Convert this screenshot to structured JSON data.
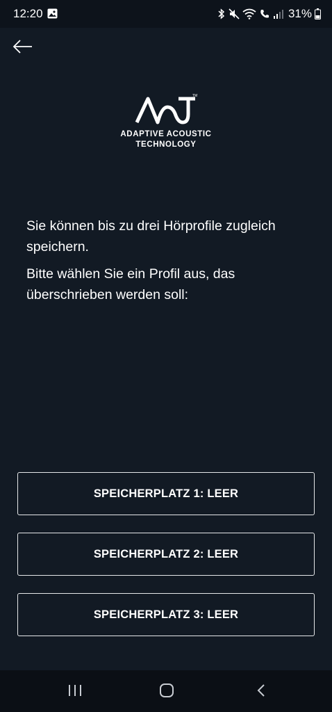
{
  "status_bar": {
    "time": "12:20",
    "battery": "31%",
    "icons": [
      "gallery-icon",
      "bluetooth-icon",
      "mute-icon",
      "wifi-icon",
      "call-icon",
      "signal-icon",
      "battery-icon"
    ]
  },
  "header": {
    "back_icon": "arrow-left-icon"
  },
  "logo": {
    "line1": "ADAPTIVE ACOUSTIC",
    "line2": "TECHNOLOGY"
  },
  "content": {
    "intro": "Sie können bis zu drei Hörprofile zugleich speichern.",
    "instruction": "Bitte wählen Sie ein Profil aus, das überschrieben werden soll:"
  },
  "slots": [
    {
      "label": "SPEICHERPLATZ 1: LEER"
    },
    {
      "label": "SPEICHERPLATZ 2: LEER"
    },
    {
      "label": "SPEICHERPLATZ 3: LEER"
    }
  ],
  "nav_bar": {
    "icons": [
      "recent-apps-icon",
      "home-icon",
      "back-icon"
    ]
  }
}
